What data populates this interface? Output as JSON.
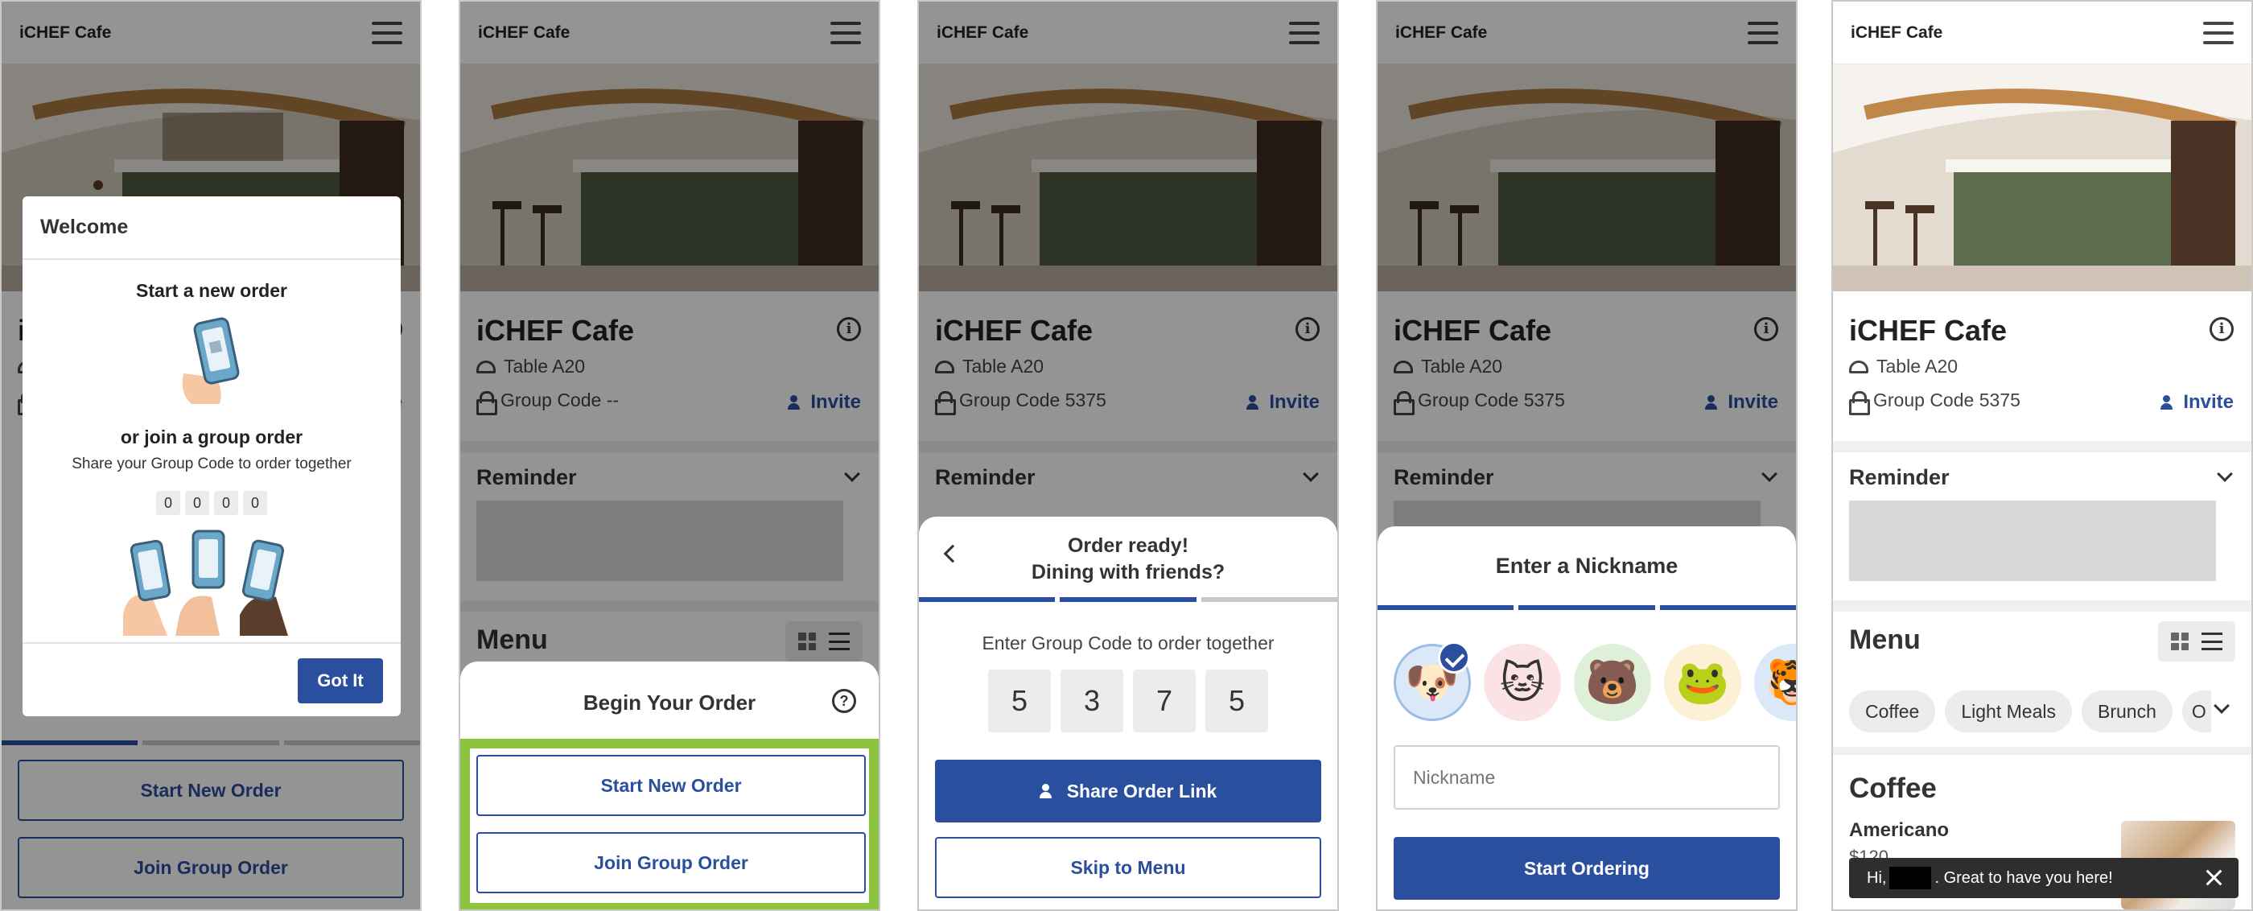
{
  "app": {
    "brand": "iCHEF Cafe",
    "store_name": "iCHEF Cafe",
    "table": "Table A20",
    "group_code_empty": "Group Code --",
    "group_code": "Group Code 5375",
    "invite": "Invite",
    "reminder": "Reminder",
    "menu": "Menu"
  },
  "welcome_dialog": {
    "title": "Welcome",
    "start_heading": "Start a new order",
    "join_heading": "or join a group order",
    "join_sub": "Share your Group Code to order together",
    "digits": [
      "0",
      "0",
      "0",
      "0"
    ],
    "got_it": "Got It"
  },
  "begin_sheet": {
    "title": "Begin Your Order",
    "start_new": "Start New Order",
    "join_group": "Join Group Order"
  },
  "group_sheet": {
    "title_line1": "Order ready!",
    "title_line2": "Dining with friends?",
    "prompt": "Enter Group Code to order together",
    "digits": [
      "5",
      "3",
      "7",
      "5"
    ],
    "share": "Share Order Link",
    "skip": "Skip to Menu"
  },
  "nickname_sheet": {
    "title": "Enter a Nickname",
    "placeholder": "Nickname",
    "start": "Start Ordering",
    "avatars": [
      {
        "icon": "dog-avatar-icon",
        "glyph": "🐶",
        "bg": "#dbe8f7"
      },
      {
        "icon": "cat-avatar-icon",
        "glyph": "🐱",
        "bg": "#fbe3e5"
      },
      {
        "icon": "bear-avatar-icon",
        "glyph": "🐻",
        "bg": "#dff0d8"
      },
      {
        "icon": "frog-avatar-icon",
        "glyph": "🐸",
        "bg": "#fdf0d5"
      },
      {
        "icon": "tiger-avatar-icon",
        "glyph": "🐯",
        "bg": "#dbe8f7"
      }
    ]
  },
  "menu_page": {
    "categories": [
      "Coffee",
      "Light Meals",
      "Brunch",
      "O"
    ],
    "section": "Coffee",
    "item_name": "Americano",
    "item_price": "$120",
    "toast_prefix": "Hi,",
    "toast_suffix": ". Great to have you here!"
  },
  "colors": {
    "primary": "#2a4f9e",
    "highlight_frame": "#8cc43f",
    "progress_off": "#c8c8c8"
  }
}
